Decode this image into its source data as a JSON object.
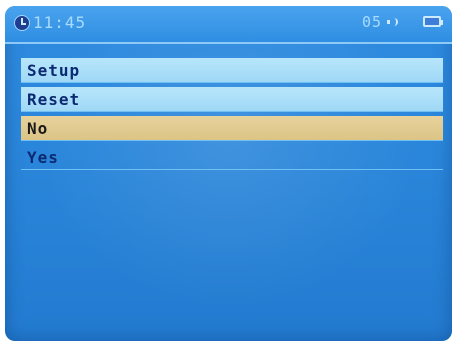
{
  "status_bar": {
    "time": "11:45",
    "volume": "05"
  },
  "icons": {
    "clock": "clock-icon",
    "speaker": "speaker-icon",
    "battery": "battery-icon"
  },
  "menu": {
    "items": [
      {
        "label": "Setup",
        "state": "normal"
      },
      {
        "label": "Reset",
        "state": "normal"
      },
      {
        "label": "No",
        "state": "selected"
      },
      {
        "label": "Yes",
        "state": "normal"
      }
    ]
  },
  "colors": {
    "screen_blue": "#2a86da",
    "row_light": "#b0e0f8",
    "row_selected": "#e2cc90",
    "text_dark_blue": "#0b2a72"
  }
}
